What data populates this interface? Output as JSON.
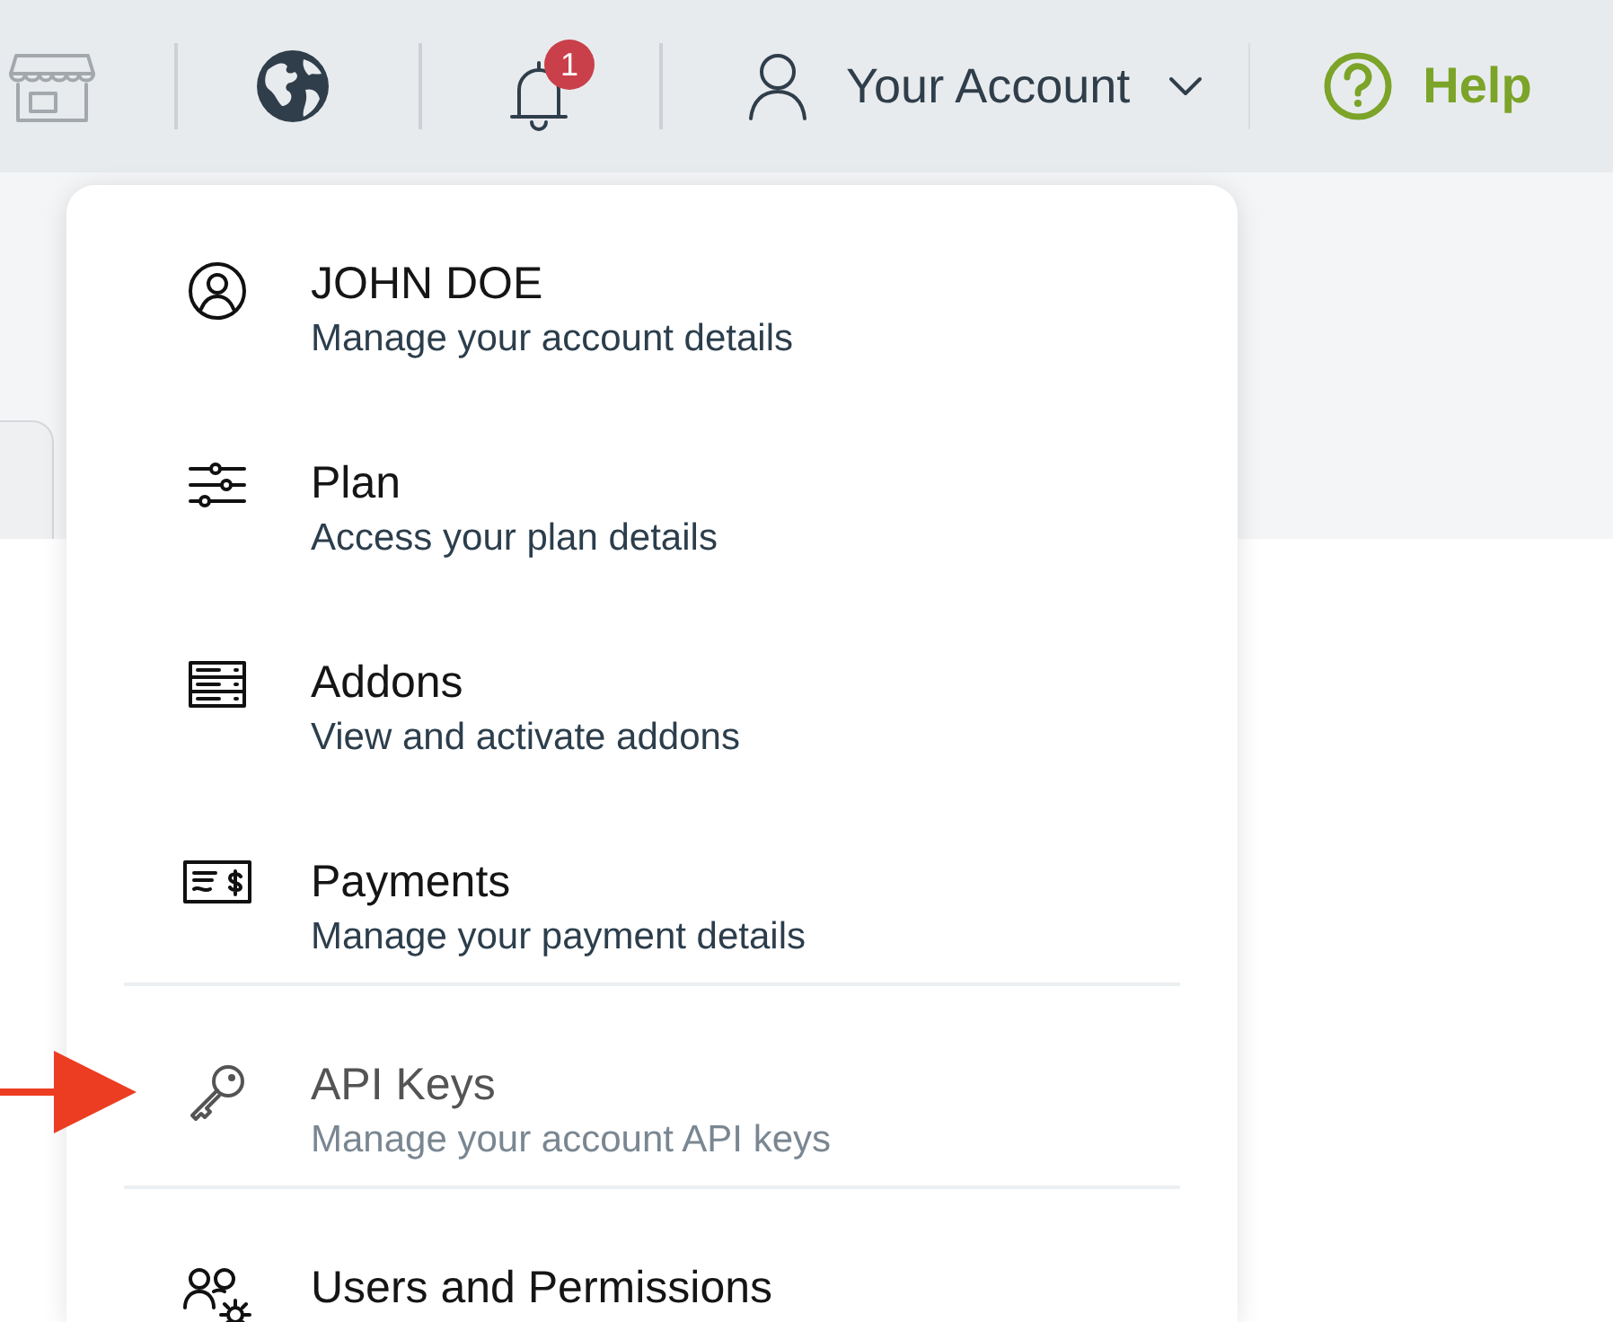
{
  "topbar": {
    "notification_count": "1",
    "account_label": "Your Account",
    "help_label": "Help"
  },
  "account_menu": {
    "items": [
      {
        "kind": "user",
        "title": "JOHN DOE",
        "subtitle": "Manage your account details",
        "disabled": false,
        "separated": false
      },
      {
        "kind": "sliders",
        "title": "Plan",
        "subtitle": "Access your plan details",
        "disabled": false,
        "separated": false
      },
      {
        "kind": "server",
        "title": "Addons",
        "subtitle": "View and activate addons",
        "disabled": false,
        "separated": false
      },
      {
        "kind": "check",
        "title": "Payments",
        "subtitle": "Manage your payment details",
        "disabled": false,
        "separated": false
      },
      {
        "kind": "key",
        "title": "API Keys",
        "subtitle": "Manage your account API keys",
        "disabled": true,
        "separated": true
      },
      {
        "kind": "users",
        "title": "Users and Permissions",
        "disabled": false,
        "separated": true
      }
    ]
  }
}
